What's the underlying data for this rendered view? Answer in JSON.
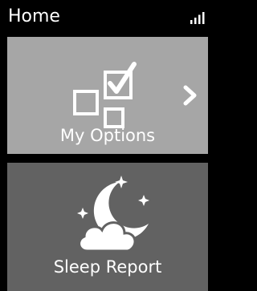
{
  "header": {
    "title": "Home",
    "signal_icon": "signal-strength-icon"
  },
  "tiles": [
    {
      "label": "My Options",
      "icon": "checkbox-options-icon",
      "nav_icon": "chevron-right-icon",
      "background": "#a6a6a6"
    },
    {
      "label": "Sleep Report",
      "icon": "moon-cloud-stars-icon",
      "background": "#626262"
    }
  ],
  "colors": {
    "background": "#000000",
    "text": "#ffffff"
  }
}
